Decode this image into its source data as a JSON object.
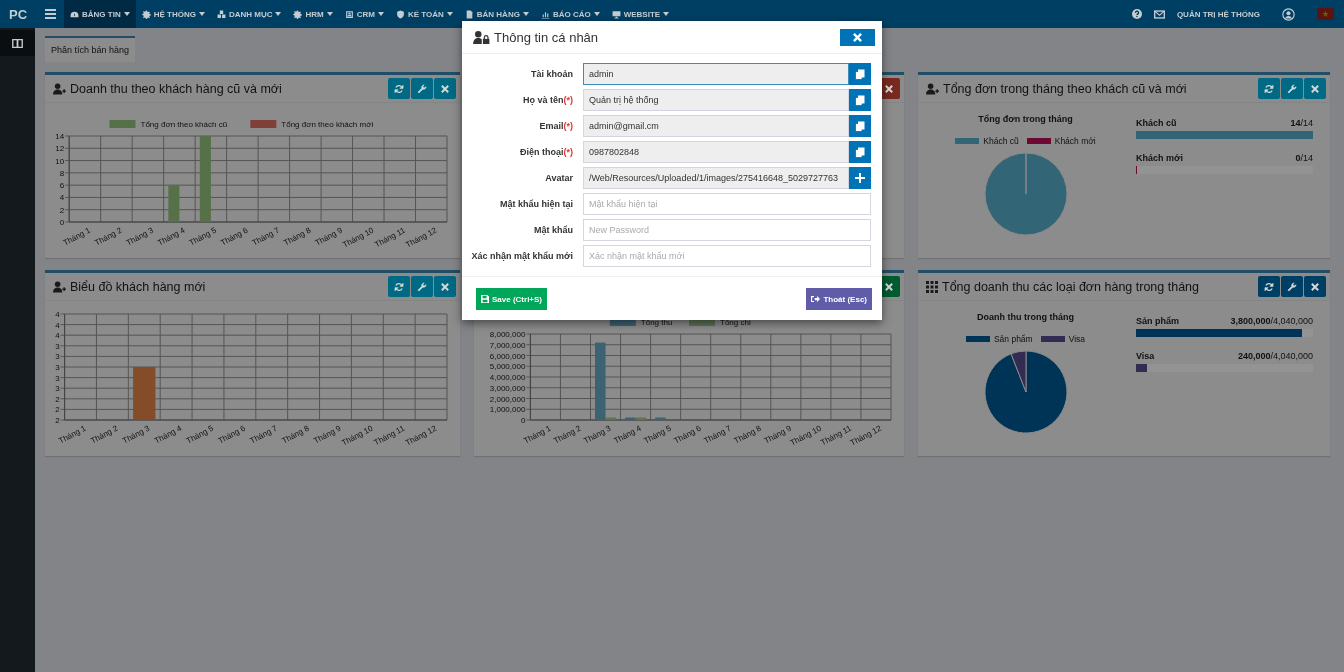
{
  "navbar": {
    "brand": "PC",
    "menu": [
      {
        "label": "BẢNG TIN",
        "selected": true
      },
      {
        "label": "HỆ THỐNG",
        "selected": false
      },
      {
        "label": "DANH MỤC",
        "selected": false
      },
      {
        "label": "HRM",
        "selected": false
      },
      {
        "label": "CRM",
        "selected": false
      },
      {
        "label": "KẾ TOÁN",
        "selected": false
      },
      {
        "label": "BÁN HÀNG",
        "selected": false
      },
      {
        "label": "BÁO CÁO",
        "selected": false
      },
      {
        "label": "WEBSITE",
        "selected": false
      }
    ],
    "user": "QUẢN TRỊ HỆ THỐNG"
  },
  "tabs": [
    {
      "label": "Phân tích bán hàng",
      "selected": true
    }
  ],
  "panels": [
    {
      "title": "Doanh thu theo khách hàng cũ và mới",
      "color": "#006983",
      "chart_data": {
        "type": "bar",
        "categories": [
          "Tháng 1",
          "Tháng 2",
          "Tháng 3",
          "Tháng 4",
          "Tháng 5",
          "Tháng 6",
          "Tháng 7",
          "Tháng 8",
          "Tháng 9",
          "Tháng 10",
          "Tháng 11",
          "Tháng 12"
        ],
        "series": [
          {
            "name": "Tổng đơn theo khách cũ",
            "color": "#567048",
            "values": [
              0,
              0,
              0,
              6,
              14,
              0,
              0,
              0,
              0,
              0,
              0,
              0
            ]
          },
          {
            "name": "Tổng đơn theo khách mới",
            "color": "#7f403a",
            "values": [
              0,
              0,
              0,
              0,
              0,
              0,
              0,
              0,
              0,
              0,
              0,
              0
            ]
          }
        ],
        "ylim": [
          0,
          14
        ],
        "yticks": [
          0,
          2,
          4,
          6,
          8,
          10,
          12,
          14
        ],
        "grid": true,
        "legend": "top"
      }
    },
    {
      "color": "#79291f"
    },
    {
      "title": "Tổng đơn trong tháng theo khách cũ và mới",
      "color": "#006983",
      "chart_data": {
        "type": "pie",
        "title": "Tổng đơn trong tháng",
        "categories": [
          "Khách cũ",
          "Khách mới"
        ],
        "values": [
          100,
          0
        ],
        "colors": [
          "#326576",
          "#6b0934"
        ],
        "legend": "top"
      },
      "progress": [
        {
          "label": "Khách cũ",
          "reading": "**14**/14",
          "level": 1,
          "color": "#326576"
        },
        {
          "label": "Khách mới",
          "reading": "**0**/14",
          "level": 0,
          "color": "#6b0934"
        }
      ]
    },
    {
      "title": "Biểu đồ khách hàng mới",
      "color": "#006983",
      "chart_data": {
        "type": "bar",
        "categories": [
          "Tháng 1",
          "Tháng 2",
          "Tháng 3",
          "Tháng 4",
          "Tháng 5",
          "Tháng 6",
          "Tháng 7",
          "Tháng 8",
          "Tháng 9",
          "Tháng 10",
          "Tháng 11",
          "Tháng 12"
        ],
        "series": [
          {
            "color": "#854c29",
            "values": [
              null,
              null,
              3,
              null,
              null,
              null,
              null,
              null,
              null,
              null,
              null,
              null
            ]
          }
        ],
        "ylim": [
          2,
          4
        ],
        "yticks": [
          {
            "value": 4,
            "label": "4"
          },
          {
            "value": 3.8,
            "label": "4"
          },
          {
            "value": 3.6,
            "label": "4"
          },
          {
            "value": 3.4,
            "label": "3"
          },
          {
            "value": 3.2,
            "label": "3"
          },
          {
            "value": 3,
            "label": "3"
          },
          {
            "value": 2.8,
            "label": "3"
          },
          {
            "value": 2.6,
            "label": "3"
          },
          {
            "value": 2.4,
            "label": "2"
          },
          {
            "value": 2.2,
            "label": "2"
          },
          {
            "value": 2,
            "label": "2"
          }
        ],
        "grid": true
      }
    },
    {
      "color": "#005b31",
      "chart_data": {
        "type": "bar",
        "categories": [
          "Tháng 1",
          "Tháng 2",
          "Tháng 3",
          "Tháng 4",
          "Tháng 5",
          "Tháng 6",
          "Tháng 7",
          "Tháng 8",
          "Tháng 9",
          "Tháng 10",
          "Tháng 11",
          "Tháng 12"
        ],
        "series": [
          {
            "name": "Tổng thu",
            "color": "#3d6273",
            "values": [
              0,
              0,
              7200000,
              100000,
              100000,
              0,
              0,
              0,
              0,
              0,
              0,
              0
            ]
          },
          {
            "name": "Tổng chi",
            "color": "#5d7555",
            "values": [
              0,
              0,
              100000,
              100000,
              0,
              0,
              0,
              0,
              0,
              0,
              0,
              0
            ]
          }
        ],
        "ylim": [
          0,
          8000000
        ],
        "yticks": [
          {
            "value": 0,
            "label": "0"
          },
          {
            "value": 1000000,
            "label": "1,000,000"
          },
          {
            "value": 2000000,
            "label": "2,000,000"
          },
          {
            "value": 3000000,
            "label": "3,000,000"
          },
          {
            "value": 4000000,
            "label": "4,000,000"
          },
          {
            "value": 5000000,
            "label": "5,000,000"
          },
          {
            "value": 6000000,
            "label": "6,000,000"
          },
          {
            "value": 7000000,
            "label": "7,000,000"
          },
          {
            "value": 8000000,
            "label": "8,000,000"
          }
        ],
        "grid": true,
        "legend": "top"
      }
    },
    {
      "title": "Tổng doanh thu các loại đơn hàng trong tháng",
      "color": "#003f64",
      "chart_data": {
        "type": "pie",
        "title": "Doanh thu trong tháng",
        "categories": [
          "Sản phẩm",
          "Visa"
        ],
        "values": [
          94.06,
          5.94
        ],
        "colors": [
          "#003457",
          "#342b52"
        ],
        "legend": "top"
      },
      "progress": [
        {
          "label": "Sản phẩm",
          "reading": "**3,800,000**/4,040,000",
          "level": 0.94,
          "color": "#003457"
        },
        {
          "label": "Visa",
          "reading": "**240,000**/4,040,000",
          "level": 0.06,
          "color": "#342b52"
        }
      ]
    }
  ],
  "modal": {
    "title": "Thông tin cá nhân",
    "fields": [
      {
        "label": "Tài khoản",
        "kind": "copy",
        "value": "admin",
        "focused": true
      },
      {
        "label": "Họ và tên",
        "mark": "(*)",
        "kind": "copy",
        "value": "Quản trị hệ thống",
        "focused": false
      },
      {
        "label": "Email",
        "mark": "(*)",
        "kind": "copy",
        "value": "admin@gmail.cm",
        "focused": false
      },
      {
        "label": "Điện thoại",
        "mark": "(*)",
        "kind": "copy",
        "value": "0987802848",
        "focused": false
      },
      {
        "label": "Avatar",
        "kind": "upload",
        "value": "/Web/Resources/Uploaded/1/images/275416648_5029727763",
        "focused": false
      },
      {
        "label": "Mật khẩu hiện tại",
        "kind": "password",
        "placeholder": "Mật khẩu hiện tại",
        "focused": false
      },
      {
        "label": "Mật khẩu",
        "kind": "password",
        "placeholder": "New Password",
        "focused": false
      },
      {
        "label": "Xác nhận mật khẩu mới",
        "kind": "password",
        "placeholder": "Xác nhận mật khẩu mới",
        "focused": false
      }
    ],
    "save": "Save (Ctrl+S)",
    "exit": "Thoát (Esc)"
  }
}
